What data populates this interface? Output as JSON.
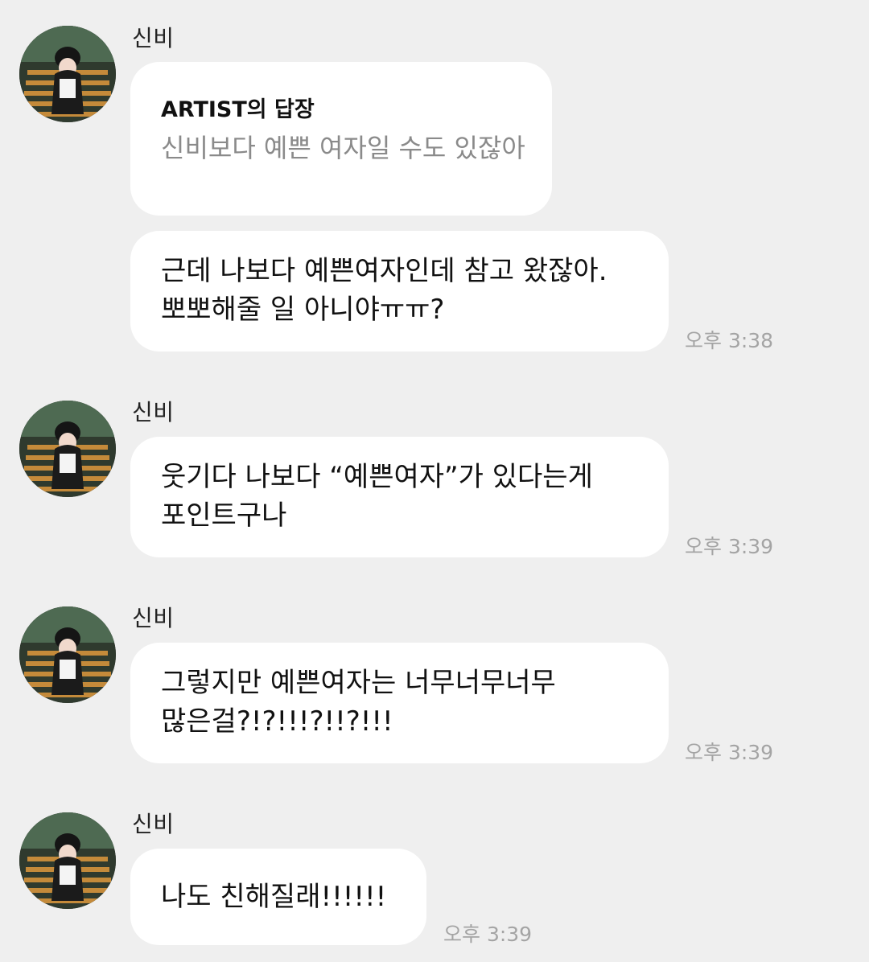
{
  "messages": [
    {
      "sender": "신비",
      "reply": {
        "title": "ARTIST의 답장",
        "text": "신비보다 예쁜 여자일 수도 있잖아"
      },
      "lines": [
        "근데 나보다 예쁜여자인데 참고 왔잖아.",
        "뽀뽀해줄 일 아니야ㅠㅠ?"
      ],
      "time": "오후 3:38"
    },
    {
      "sender": "신비",
      "lines": [
        "웃기다 나보다 “예쁜여자”가 있다는게",
        "포인트구나"
      ],
      "time": "오후 3:39"
    },
    {
      "sender": "신비",
      "lines": [
        "그렇지만 예쁜여자는 너무너무너무",
        "많은걸?!?!!!?!!?!!!"
      ],
      "time": "오후 3:39"
    },
    {
      "sender": "신비",
      "lines": [
        "나도 친해질래!!!!!!"
      ],
      "time": "오후 3:39"
    }
  ]
}
